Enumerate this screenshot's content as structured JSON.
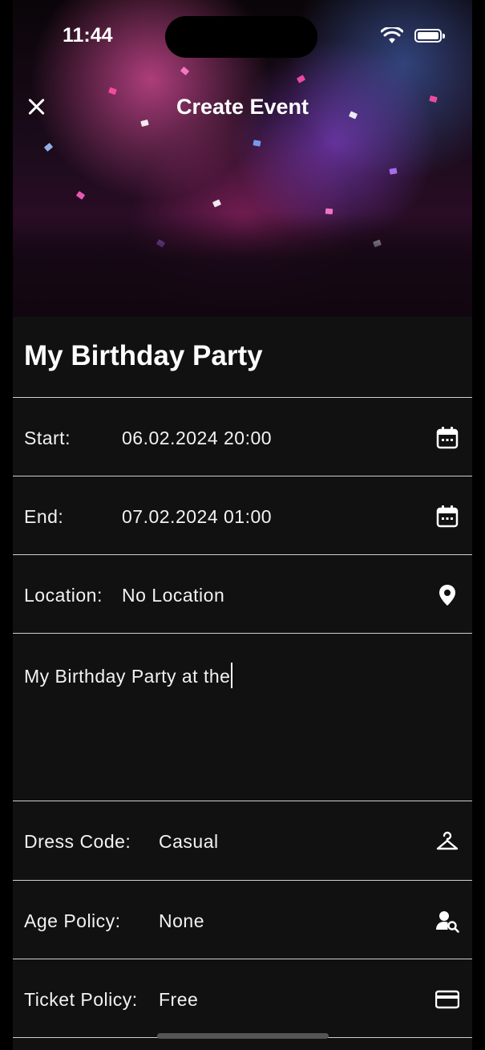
{
  "status_bar": {
    "time": "11:44"
  },
  "nav": {
    "title": "Create Event"
  },
  "event": {
    "title": "My Birthday Party",
    "start_label": "Start:",
    "start_value": "06.02.2024 20:00",
    "end_label": "End:",
    "end_value": "07.02.2024 01:00",
    "location_label": "Location:",
    "location_value": "No Location",
    "description": "My Birthday Party at the",
    "dress_code_label": "Dress Code:",
    "dress_code_value": "Casual",
    "age_policy_label": "Age Policy:",
    "age_policy_value": "None",
    "ticket_policy_label": "Ticket Policy:",
    "ticket_policy_value": "Free"
  },
  "icons": {
    "start": "calendar-icon",
    "end": "calendar-icon",
    "location": "location-pin-icon",
    "dress_code": "hanger-icon",
    "age_policy": "person-search-icon",
    "ticket_policy": "credit-card-icon"
  },
  "colors": {
    "background": "#111111",
    "text": "#ffffff",
    "divider": "#cfcfcf"
  }
}
